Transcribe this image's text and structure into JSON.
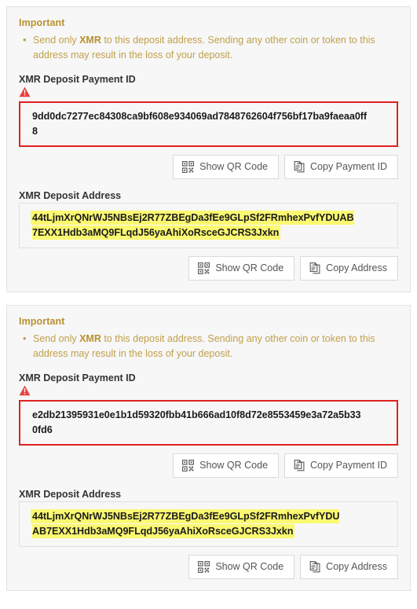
{
  "cards": [
    {
      "important": {
        "title": "Important",
        "bullet_prefix": "Send only ",
        "bullet_bold": "XMR",
        "bullet_suffix": " to this deposit address. Sending any other coin or token to this address may result in the loss of your deposit."
      },
      "payment_id": {
        "label": "XMR Deposit Payment ID",
        "warning_icon": "warning-triangle-icon",
        "value": "9dd0dc7277ec84308ca9bf608e934069ad7848762604f756bf17ba9faeaa0ff8",
        "border_color": "#e02020",
        "buttons": [
          {
            "icon": "qr-code-icon",
            "label": "Show QR Code"
          },
          {
            "icon": "copy-icon",
            "label": "Copy Payment ID"
          }
        ]
      },
      "address": {
        "label": "XMR Deposit Address",
        "value": "44tLjmXrQNrWJ5NBsEj2R77ZBEgDa3fEe9GLpSf2FRmhexPvfYDUAB7EXX1Hdb3aMQ9FLqdJ56yaAhiXoRsceGJCRS3Jxkn",
        "highlight_color": "#fbf871",
        "buttons": [
          {
            "icon": "qr-code-icon",
            "label": "Show QR Code"
          },
          {
            "icon": "copy-icon",
            "label": "Copy Address"
          }
        ]
      }
    },
    {
      "important": {
        "title": "Important",
        "bullet_prefix": "Send only ",
        "bullet_bold": "XMR",
        "bullet_suffix": " to this deposit address. Sending any other coin or token to this address may result in the loss of your deposit."
      },
      "payment_id": {
        "label": "XMR Deposit Payment ID",
        "warning_icon": "warning-triangle-icon",
        "value": "e2db21395931e0e1b1d59320fbb41b666ad10f8d72e8553459e3a72a5b330fd6",
        "border_color": "#e02020",
        "buttons": [
          {
            "icon": "qr-code-icon",
            "label": "Show QR Code"
          },
          {
            "icon": "copy-icon",
            "label": "Copy Payment ID"
          }
        ]
      },
      "address": {
        "label": "XMR Deposit Address",
        "value": "44tLjmXrQNrWJ5NBsEj2R77ZBEgDa3fEe9GLpSf2FRmhexPvfYDUAB7EXX1Hdb3aMQ9FLqdJ56yaAhiXoRsceGJCRS3Jxkn",
        "highlight_color": "#fbf871",
        "buttons": [
          {
            "icon": "qr-code-icon",
            "label": "Show QR Code"
          },
          {
            "icon": "copy-icon",
            "label": "Copy Address"
          }
        ]
      }
    }
  ]
}
